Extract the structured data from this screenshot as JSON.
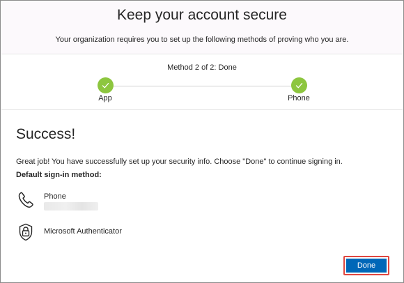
{
  "header": {
    "title": "Keep your account secure",
    "description": "Your organization requires you to set up the following methods of proving who you are."
  },
  "progress": {
    "status": "Method 2 of 2: Done",
    "steps": [
      {
        "label": "App",
        "icon": "checkmark-icon",
        "state": "complete"
      },
      {
        "label": "Phone",
        "icon": "checkmark-icon",
        "state": "complete"
      }
    ]
  },
  "success": {
    "title": "Success!",
    "message": "Great job! You have successfully set up your security info. Choose \"Done\" to continue signing in.",
    "default_method_label": "Default sign-in method:"
  },
  "methods": [
    {
      "name": "Phone",
      "icon": "phone-icon",
      "detail_redacted": true
    },
    {
      "name": "Microsoft Authenticator",
      "icon": "authenticator-lock-icon"
    }
  ],
  "actions": {
    "done_label": "Done"
  },
  "colors": {
    "accent": "#0067b8",
    "step_complete": "#8dc63f",
    "highlight": "#e0463f",
    "header_bg": "#fcf9fc"
  }
}
